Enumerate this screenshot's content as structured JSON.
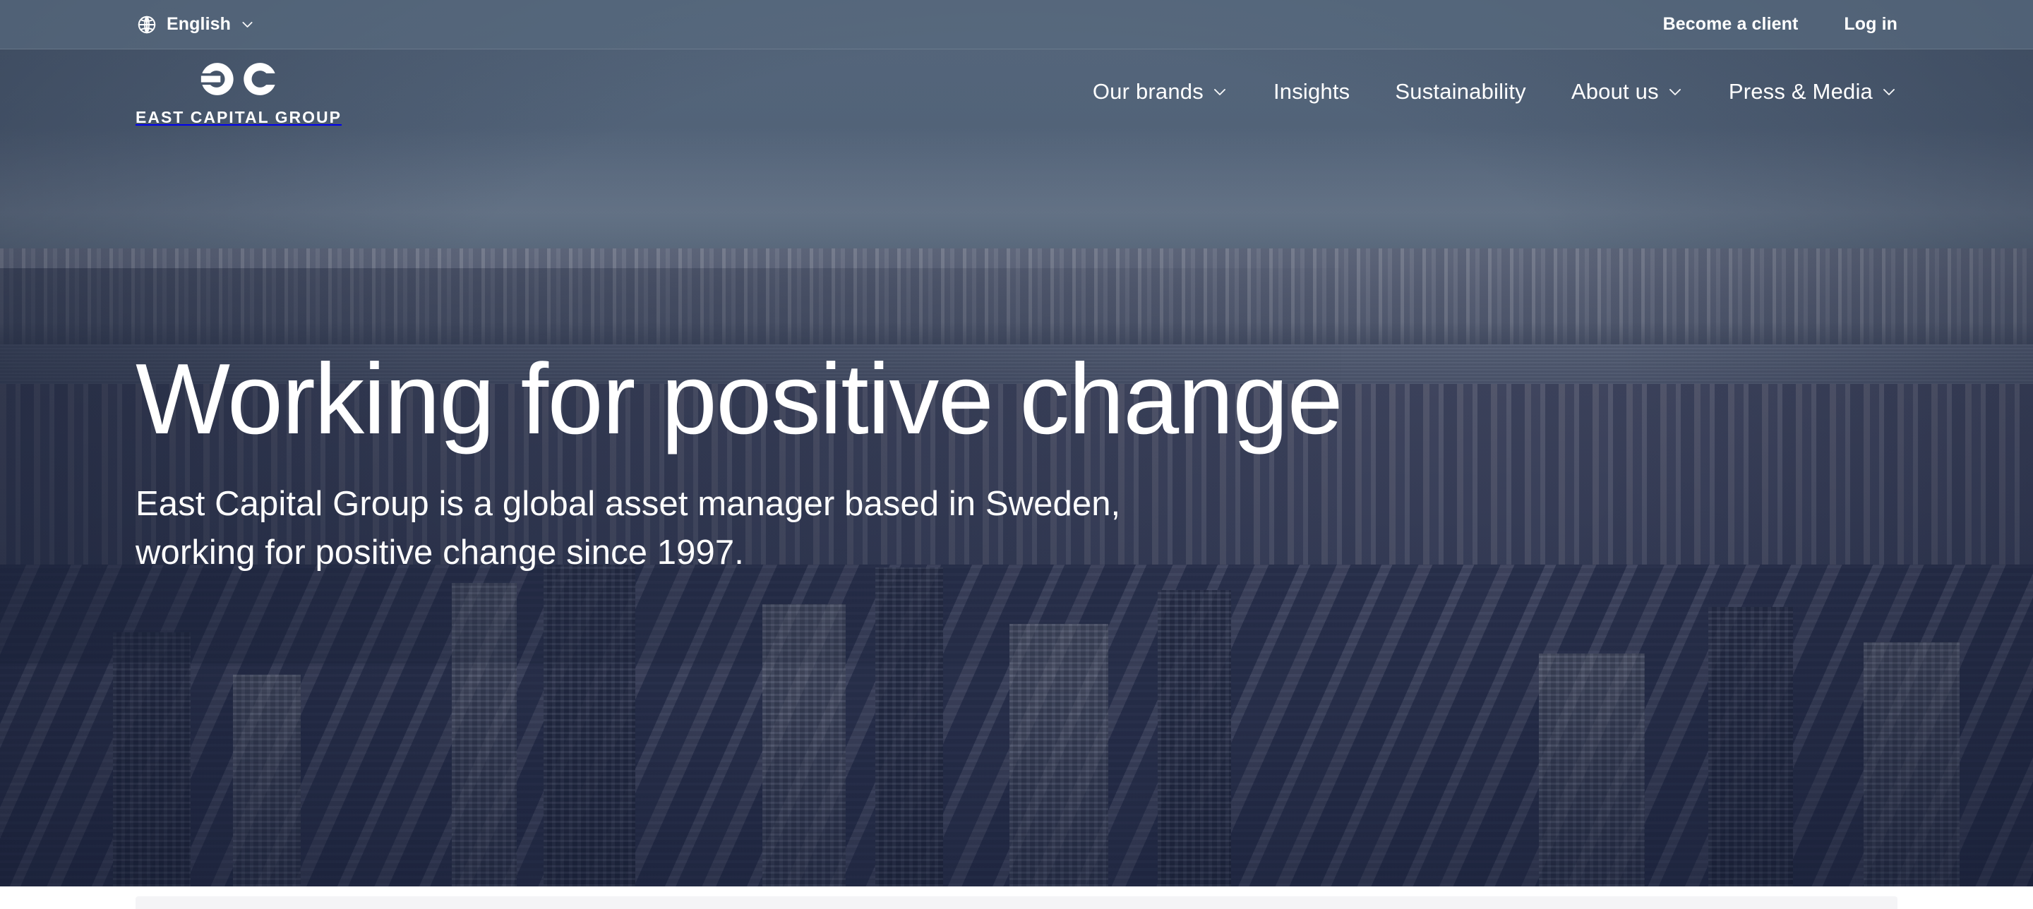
{
  "site": {
    "brand_name": "East Capital Group",
    "logo_wordmark": "EAST CAPITAL GROUP",
    "logo_mark_icon": "ec-monogram-icon"
  },
  "topbar": {
    "language": {
      "icon": "globe-icon",
      "label": "English",
      "chevron_icon": "chevron-down-icon"
    },
    "links": [
      {
        "label": "Become a client"
      },
      {
        "label": "Log in"
      }
    ]
  },
  "nav": {
    "items": [
      {
        "label": "Our brands",
        "has_dropdown": true,
        "chevron_icon": "chevron-down-icon"
      },
      {
        "label": "Insights",
        "has_dropdown": false,
        "chevron_icon": ""
      },
      {
        "label": "Sustainability",
        "has_dropdown": false,
        "chevron_icon": ""
      },
      {
        "label": "About us",
        "has_dropdown": true,
        "chevron_icon": "chevron-down-icon"
      },
      {
        "label": "Press & Media",
        "has_dropdown": true,
        "chevron_icon": "chevron-down-icon"
      }
    ]
  },
  "hero": {
    "title": "Working for positive change",
    "subtitle": "East Capital Group is a global asset manager based in Sweden, working for positive change since 1997.",
    "background_description": "Aerial photograph of a city skyline at dusk with a blue colour grade"
  },
  "colors": {
    "topbar_bg": "#58697e",
    "hero_sky": "#5b6d80",
    "hero_foreground": "#333b58",
    "text_on_hero": "#ffffff",
    "page_bg": "#ffffff"
  }
}
